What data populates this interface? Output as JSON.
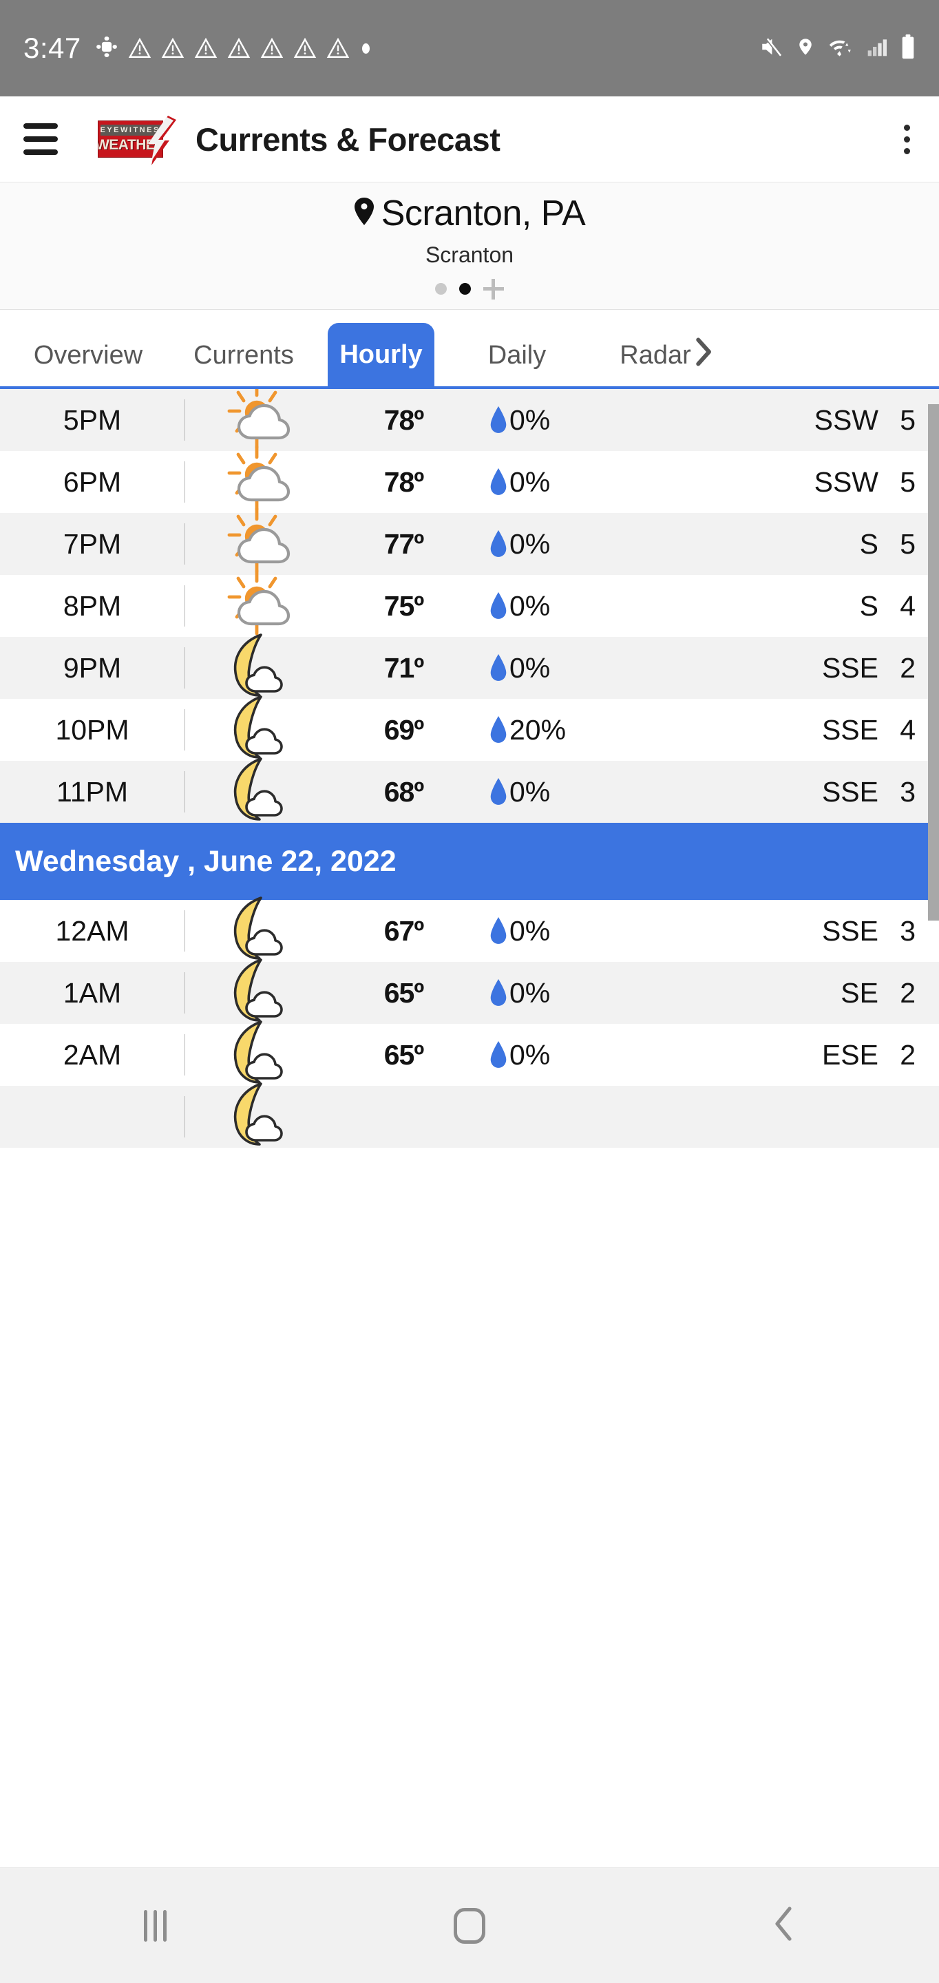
{
  "statusbar": {
    "time": "3:47",
    "icons": [
      "slack-clover-icon",
      "warning-triangle-icon",
      "warning-triangle-icon",
      "warning-triangle-icon",
      "warning-triangle-icon",
      "warning-triangle-icon",
      "warning-triangle-icon",
      "warning-triangle-icon",
      "small-dot-icon"
    ],
    "right_icons": [
      "mute-icon",
      "location-icon",
      "wifi-icon",
      "signal-icon",
      "battery-icon"
    ],
    "bg_color": "#7d7d7d"
  },
  "appbar": {
    "menu_icon": "hamburger-icon",
    "logo_top_text": "EYEWITNESS",
    "logo_bottom_text": "WEATHER",
    "title": "Currents & Forecast",
    "overflow_icon": "more-vertical-icon",
    "logo_red": "#c7161d"
  },
  "location": {
    "pin_icon": "location-pin-icon",
    "city": "Scranton, PA",
    "sublabel": "Scranton",
    "pager": {
      "dots": [
        "inactive",
        "active"
      ],
      "add_label": "+"
    }
  },
  "tabs": [
    {
      "label": "Overview",
      "active": false
    },
    {
      "label": "Currents",
      "active": false
    },
    {
      "label": "Hourly",
      "active": true
    },
    {
      "label": "Daily",
      "active": false
    },
    {
      "label": "Radar",
      "active": false
    }
  ],
  "tab_accent": "#3c74e0",
  "hourly": {
    "columns": [
      "time",
      "condition",
      "temperature",
      "precip",
      "wind_dir",
      "wind_speed"
    ],
    "rows": [
      {
        "type": "hour",
        "time": "5PM",
        "icon": "partly-cloudy-day-icon",
        "temp": "78º",
        "pop": "0%",
        "dir": "SSW",
        "spd": "5",
        "shade": "alt"
      },
      {
        "type": "hour",
        "time": "6PM",
        "icon": "partly-cloudy-day-icon",
        "temp": "78º",
        "pop": "0%",
        "dir": "SSW",
        "spd": "5",
        "shade": "plain"
      },
      {
        "type": "hour",
        "time": "7PM",
        "icon": "partly-cloudy-day-icon",
        "temp": "77º",
        "pop": "0%",
        "dir": "S",
        "spd": "5",
        "shade": "alt"
      },
      {
        "type": "hour",
        "time": "8PM",
        "icon": "partly-cloudy-day-icon",
        "temp": "75º",
        "pop": "0%",
        "dir": "S",
        "spd": "4",
        "shade": "plain"
      },
      {
        "type": "hour",
        "time": "9PM",
        "icon": "partly-cloudy-night-icon",
        "temp": "71º",
        "pop": "0%",
        "dir": "SSE",
        "spd": "2",
        "shade": "alt"
      },
      {
        "type": "hour",
        "time": "10PM",
        "icon": "partly-cloudy-night-icon",
        "temp": "69º",
        "pop": "20%",
        "dir": "SSE",
        "spd": "4",
        "shade": "plain"
      },
      {
        "type": "hour",
        "time": "11PM",
        "icon": "partly-cloudy-night-icon",
        "temp": "68º",
        "pop": "0%",
        "dir": "SSE",
        "spd": "3",
        "shade": "alt"
      },
      {
        "type": "daysep",
        "label": "Wednesday , June 22, 2022"
      },
      {
        "type": "hour",
        "time": "12AM",
        "icon": "partly-cloudy-night-icon",
        "temp": "67º",
        "pop": "0%",
        "dir": "SSE",
        "spd": "3",
        "shade": "plain"
      },
      {
        "type": "hour",
        "time": "1AM",
        "icon": "partly-cloudy-night-icon",
        "temp": "65º",
        "pop": "0%",
        "dir": "SE",
        "spd": "2",
        "shade": "alt"
      },
      {
        "type": "hour",
        "time": "2AM",
        "icon": "partly-cloudy-night-icon",
        "temp": "65º",
        "pop": "0%",
        "dir": "ESE",
        "spd": "2",
        "shade": "plain"
      },
      {
        "type": "hour",
        "time": "",
        "icon": "partly-cloudy-night-icon",
        "temp": "",
        "pop": "",
        "dir": "",
        "spd": "",
        "shade": "alt"
      }
    ]
  },
  "navbar": {
    "recents_label": "recents-icon",
    "home_label": "home-icon",
    "back_label": "back-icon"
  }
}
